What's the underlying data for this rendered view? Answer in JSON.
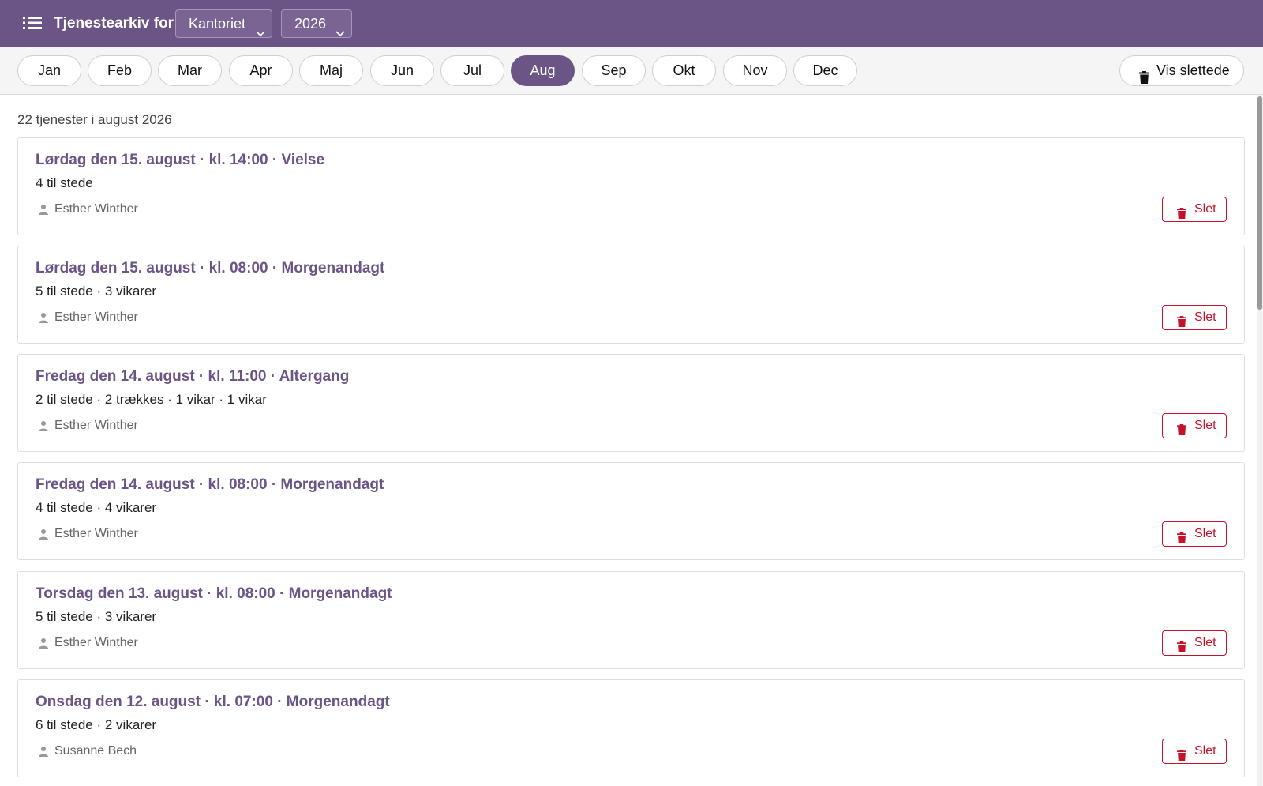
{
  "header": {
    "title": "Tjenestearkiv for",
    "choir": "Kantoriet",
    "year": "2026",
    "menu_icon": "list-icon",
    "background": "#6b5486"
  },
  "months": [
    "Jan",
    "Feb",
    "Mar",
    "Apr",
    "Maj",
    "Jun",
    "Jul",
    "Aug",
    "Sep",
    "Okt",
    "Nov",
    "Dec"
  ],
  "active_month": "Aug",
  "show_deleted": {
    "label": "Vis slettede",
    "icon": "trash-icon"
  },
  "summary": "22 tjenester i august 2026",
  "delete_label": "Slet",
  "accent_color": "#6b5486",
  "danger_color": "#c4122b",
  "services": [
    {
      "title": "Lørdag den 15. august · kl. 14:00 · Vielse",
      "details": "4 til stede",
      "person": "Esther Winther"
    },
    {
      "title": "Lørdag den 15. august · kl. 08:00 · Morgenandagt",
      "details": "5 til stede · 3 vikarer",
      "person": "Esther Winther"
    },
    {
      "title": "Fredag den 14. august · kl. 11:00 · Altergang",
      "details": "2 til stede · 2 trækkes · 1 vikar · 1 vikar",
      "person": "Esther Winther"
    },
    {
      "title": "Fredag den 14. august · kl. 08:00 · Morgenandagt",
      "details": "4 til stede · 4 vikarer",
      "person": "Esther Winther"
    },
    {
      "title": "Torsdag den 13. august · kl. 08:00 · Morgenandagt",
      "details": "5 til stede · 3 vikarer",
      "person": "Esther Winther"
    },
    {
      "title": "Onsdag den 12. august · kl. 07:00 · Morgenandagt",
      "details": "6 til stede · 2 vikarer",
      "person": "Susanne Bech"
    }
  ]
}
